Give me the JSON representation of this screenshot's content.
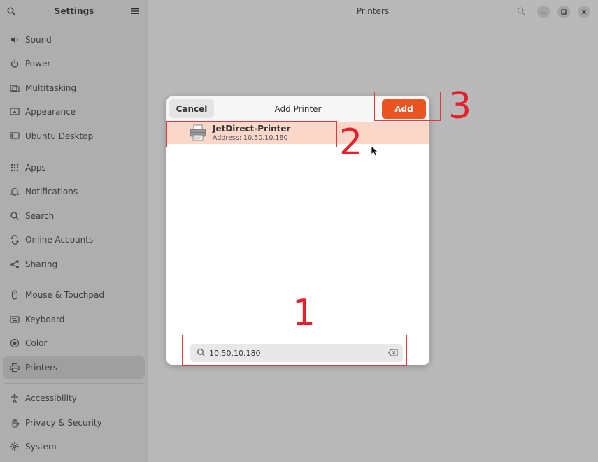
{
  "sidebar": {
    "title": "Settings",
    "items": [
      {
        "label": "Sound",
        "icon": "speaker-icon"
      },
      {
        "label": "Power",
        "icon": "power-icon"
      },
      {
        "label": "Multitasking",
        "icon": "multitasking-icon"
      },
      {
        "label": "Appearance",
        "icon": "appearance-icon"
      },
      {
        "label": "Ubuntu Desktop",
        "icon": "desktop-icon"
      },
      {
        "label": "Apps",
        "icon": "apps-grid-icon"
      },
      {
        "label": "Notifications",
        "icon": "bell-icon"
      },
      {
        "label": "Search",
        "icon": "search-icon"
      },
      {
        "label": "Online Accounts",
        "icon": "cloud-icon"
      },
      {
        "label": "Sharing",
        "icon": "share-icon"
      },
      {
        "label": "Mouse & Touchpad",
        "icon": "mouse-icon"
      },
      {
        "label": "Keyboard",
        "icon": "keyboard-icon"
      },
      {
        "label": "Color",
        "icon": "color-icon"
      },
      {
        "label": "Printers",
        "icon": "printer-icon"
      },
      {
        "label": "Accessibility",
        "icon": "accessibility-icon"
      },
      {
        "label": "Privacy & Security",
        "icon": "hand-icon"
      },
      {
        "label": "System",
        "icon": "gear-icon"
      }
    ],
    "active": "Printers"
  },
  "header": {
    "title": "Printers"
  },
  "dialog": {
    "title": "Add Printer",
    "cancel_label": "Cancel",
    "add_label": "Add",
    "printer": {
      "name": "JetDirect-Printer",
      "address": "Address: 10.50.10.180"
    },
    "search_value": "10.50.10.180"
  },
  "annotations": [
    "1",
    "2",
    "3"
  ],
  "colors": {
    "accent": "#e95420",
    "selected_row": "#fbd7ca",
    "annotation": "#e5202b"
  }
}
